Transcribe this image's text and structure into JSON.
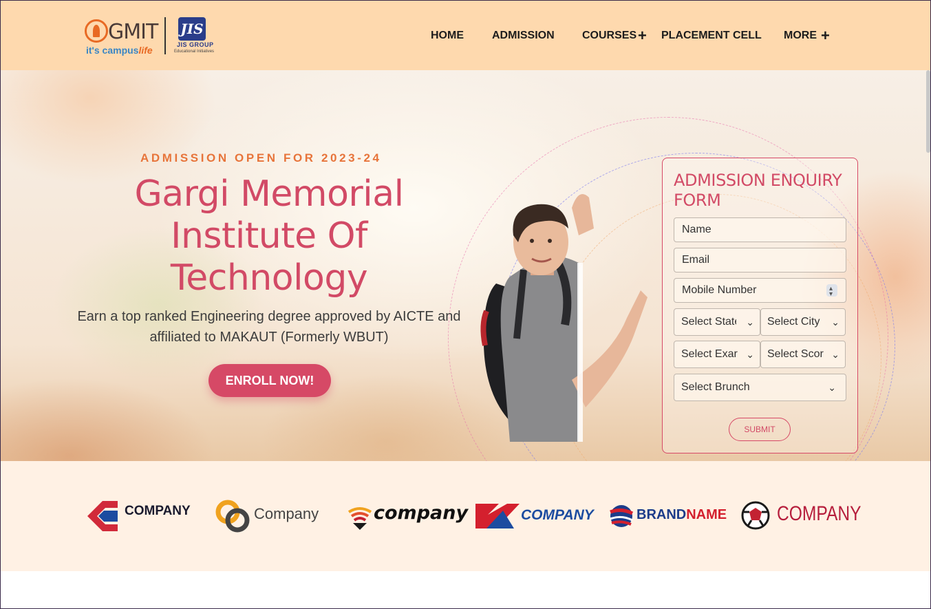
{
  "header": {
    "logo": {
      "gmit": "GMIT",
      "tagline_main": "it's campus",
      "tagline_accent": "life",
      "jis_mark": "JIS",
      "jis_group": "JIS GROUP",
      "jis_sub": "Educational Initiatives"
    },
    "nav": [
      {
        "label": "HOME"
      },
      {
        "label": "ADMISSION"
      },
      {
        "label": "COURSES",
        "expand": "+"
      },
      {
        "label": "PLACEMENT CELL"
      },
      {
        "label": "MORE",
        "expand": "+"
      }
    ],
    "bg_color": "#fed9ae"
  },
  "hero": {
    "kicker": "ADMISSION OPEN FOR 2023-24",
    "title_line1": "Gargi Memorial",
    "title_line2": "Institute Of",
    "title_line3": "Technology",
    "subtitle_line1": "Earn a top ranked Engineering degree approved by AICTE and",
    "subtitle_line2": "affiliated to MAKAUT (Formerly WBUT)",
    "cta": "ENROLL NOW!"
  },
  "form": {
    "title_line1": "ADMISSION ENQUIRY",
    "title_line2": "FORM",
    "name_placeholder": "Name",
    "email_placeholder": "Email",
    "mobile_placeholder": "Mobile Number",
    "state_select": "Select Statе",
    "city_select": "Select City",
    "exam_select": "Select Exar",
    "score_select": "Select Scor",
    "branch_select": "Select Brunch",
    "submit": "SUBMIT"
  },
  "partners": [
    {
      "name": "COMPANY",
      "icon": "c-arrow-logo"
    },
    {
      "name": "Company",
      "icon": "chain-link-logo"
    },
    {
      "name": "company",
      "icon": "fan-logo"
    },
    {
      "name": "COMPANY",
      "icon": "swoosh-logo"
    },
    {
      "name": "BRAND",
      "name2": "NAME",
      "icon": "globe-stripe-logo"
    },
    {
      "name": "COMPANY",
      "icon": "soccer-ball-logo"
    }
  ],
  "colors": {
    "accent": "#d64966",
    "orange": "#e7743a",
    "strip": "#fff1e4"
  }
}
